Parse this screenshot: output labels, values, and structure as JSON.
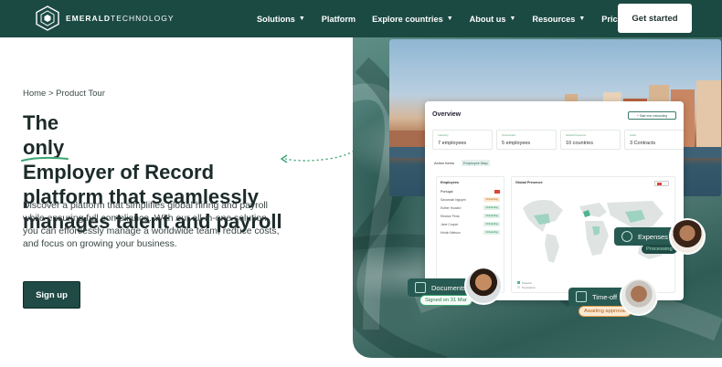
{
  "brand": {
    "name_bold": "EMERALD",
    "name_light": "TECHNOLOGY"
  },
  "nav": {
    "items": [
      {
        "label": "Solutions",
        "has_dropdown": true
      },
      {
        "label": "Platform",
        "has_dropdown": false
      },
      {
        "label": "Explore countries",
        "has_dropdown": true
      },
      {
        "label": "About us",
        "has_dropdown": true
      },
      {
        "label": "Resources",
        "has_dropdown": true
      },
      {
        "label": "Pricing",
        "has_dropdown": false
      }
    ],
    "cta_label": "Get started"
  },
  "hero": {
    "breadcrumb": "Home > Product Tour",
    "headline_pre": "The ",
    "headline_emphasis": "only",
    "headline_line1_rest": " Employer of Record",
    "headline_line2": "platform that seamlessly",
    "headline_line3": "manages talent and payroll",
    "description": "Discover a platform that simplifies global hiring and payroll while ensuring full compliance. With our all-in-one solution, you can effortlessly manage a worldwide team, reduce costs, and focus on growing your business.",
    "signup_label": "Sign up"
  },
  "dashboard": {
    "title": "Overview",
    "action": "+ Start new onboarding",
    "stats": [
      {
        "key": "Inactivity",
        "value": "7 employees"
      },
      {
        "key": "Onboarded",
        "value": "5 employees"
      },
      {
        "key": "Global Presence",
        "value": "10 countries"
      },
      {
        "key": "Audit",
        "value": "3 Contracts"
      }
    ],
    "tabs": [
      "Action Items",
      "Employee Map"
    ],
    "employees_title": "Employees",
    "country": "Portugal",
    "employees": [
      {
        "name": "Savannah Nguyen",
        "status": "Onboarding"
      },
      {
        "name": "Esther Howard",
        "status": "Onboarding"
      },
      {
        "name": "Eleanor Pena",
        "status": "Onboarding"
      },
      {
        "name": "Jane Cooper",
        "status": "Onboarding"
      },
      {
        "name": "Kristin Watson",
        "status": "Onboarding"
      }
    ],
    "map_title": "Global Presence",
    "legend": [
      "Presence",
      "No presence"
    ]
  },
  "callouts": {
    "expenses": {
      "label": "Expenses",
      "status": "Processing"
    },
    "documents": {
      "label": "Documents",
      "status": "Signed on 31 Mar"
    },
    "timeoff": {
      "label": "Time-off",
      "status": "Awaiting approval"
    }
  },
  "colors": {
    "nav_bg": "#1b4a43",
    "accent": "#3aa673",
    "button_dark": "#1f4a45"
  }
}
